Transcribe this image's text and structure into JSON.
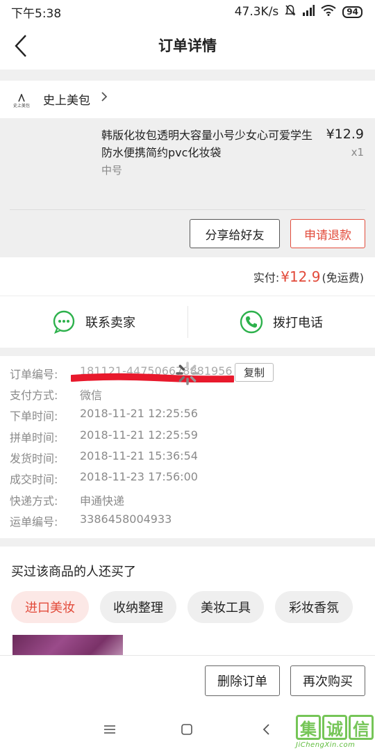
{
  "status_bar": {
    "time": "下午5:38",
    "network_speed": "47.3K/s",
    "battery": "94"
  },
  "header": {
    "title": "订单详情"
  },
  "store": {
    "name": "史上美包",
    "logo_text": "史上美包"
  },
  "product": {
    "title": "韩版化妆包透明大容量小号少女心可爱学生防水便携简约pvc化妆袋",
    "spec": "中号",
    "price": "¥12.9",
    "quantity": "x1",
    "share_label": "分享给好友",
    "refund_label": "申请退款"
  },
  "payment": {
    "label": "实付:",
    "amount": "¥12.9",
    "note": "(免运费)"
  },
  "contact": {
    "seller_label": "联系卖家",
    "call_label": "拨打电话"
  },
  "order_details": {
    "order_no_label": "订单编号:",
    "order_no_visible": "181121-447506678881956",
    "copy_label": "复制",
    "rows": [
      {
        "label": "支付方式:",
        "value": "微信"
      },
      {
        "label": "下单时间:",
        "value": "2018-11-21 12:25:56"
      },
      {
        "label": "拼单时间:",
        "value": "2018-11-21 12:25:59"
      },
      {
        "label": "发货时间:",
        "value": "2018-11-21 15:36:54"
      },
      {
        "label": "成交时间:",
        "value": "2018-11-23 17:56:00"
      },
      {
        "label": "快递方式:",
        "value": "申通快递"
      },
      {
        "label": "运单编号:",
        "value": "3386458004933"
      }
    ]
  },
  "recommend": {
    "title": "买过该商品的人还买了",
    "chips": [
      "进口美妆",
      "收纳整理",
      "美妆工具",
      "彩妆香氛"
    ]
  },
  "bottom_actions": {
    "delete_label": "删除订单",
    "rebuy_label": "再次购买"
  },
  "watermark": {
    "chars": [
      "集",
      "诚",
      "信"
    ],
    "url": "JiChengXin.com"
  },
  "colors": {
    "accent_red": "#e24a3a",
    "wechat_green": "#2db14c",
    "watermark_green": "#5dbb3a"
  }
}
